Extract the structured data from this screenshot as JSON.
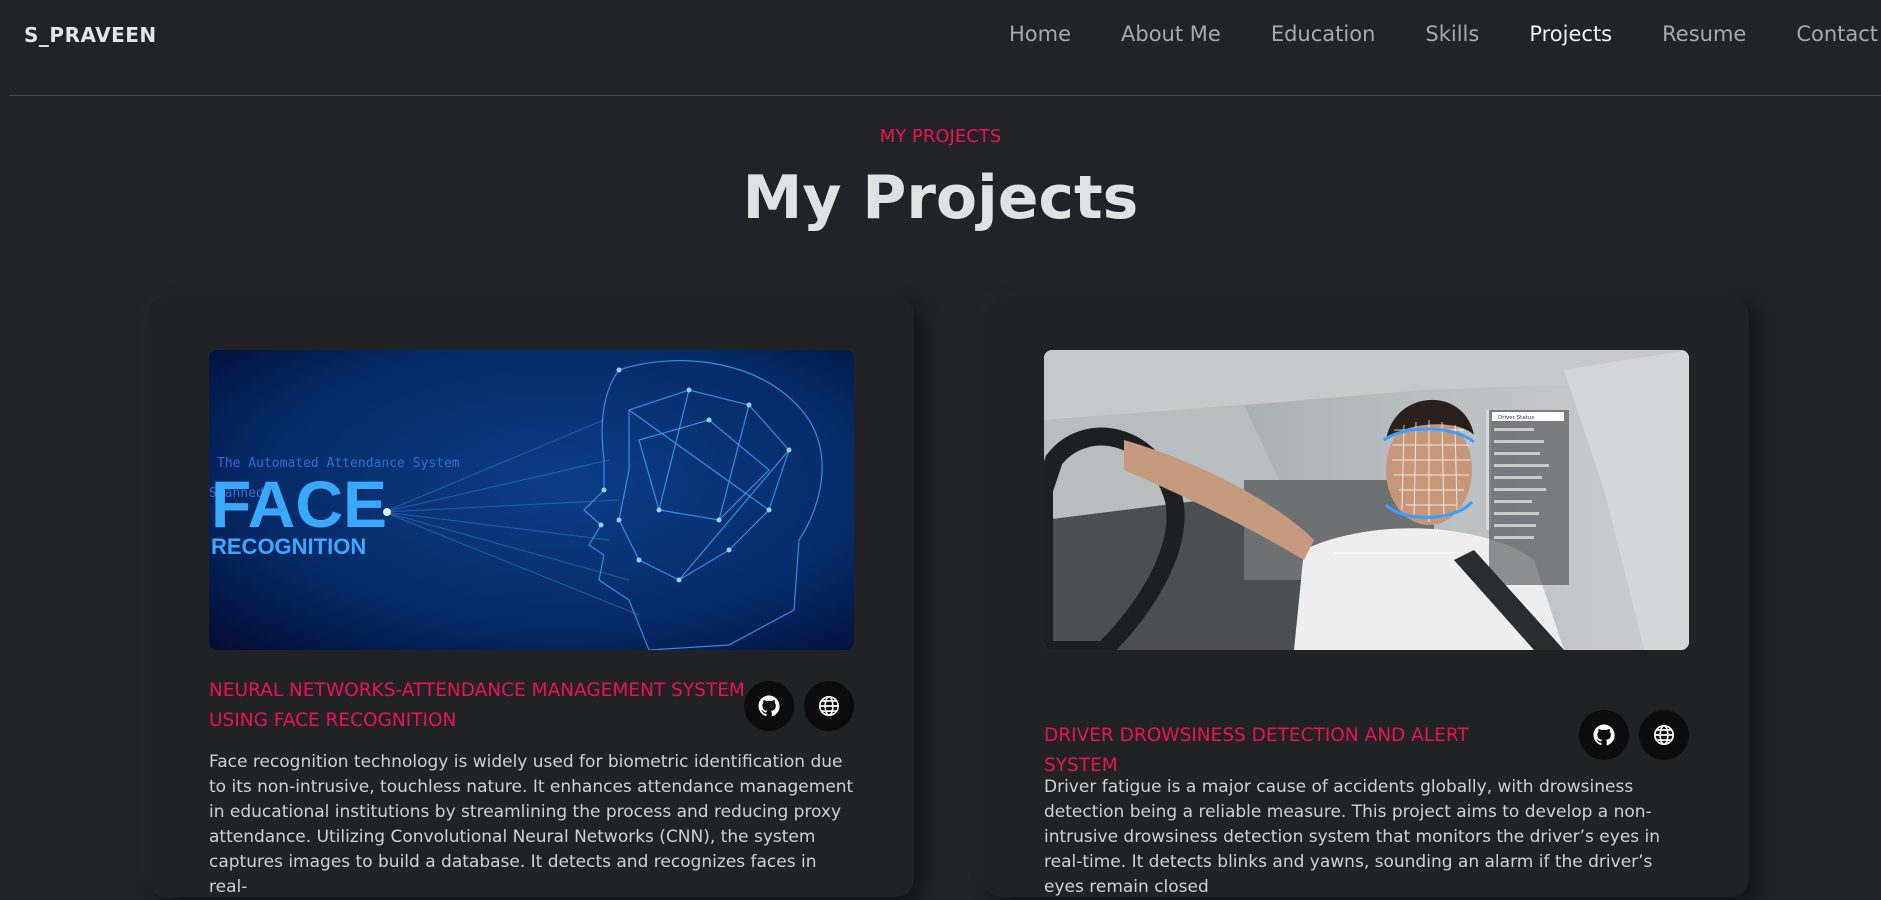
{
  "header": {
    "brand": "S_PRAVEEN",
    "nav": [
      {
        "label": "Home"
      },
      {
        "label": "About Me"
      },
      {
        "label": "Education"
      },
      {
        "label": "Skills"
      },
      {
        "label": "Projects",
        "active": true
      },
      {
        "label": "Resume"
      },
      {
        "label": "Contact"
      }
    ]
  },
  "section": {
    "eyebrow": "MY PROJECTS",
    "title": "My Projects"
  },
  "projects": [
    {
      "image_text": {
        "caption": "The Automated Attendance System",
        "subcaption": "Scanned",
        "big": "FACE",
        "small": "RECOGNITION"
      },
      "title": "NEURAL NETWORKS-ATTENDANCE MANAGEMENT SYSTEM USING FACE RECOGNITION",
      "description": "Face recognition technology is widely used for biometric identification due to its non-intrusive, touchless nature. It enhances attendance management in educational institutions by streamlining the process and reducing proxy attendance. Utilizing Convolutional Neural Networks (CNN), the system captures images to build a database. It detects and recognizes faces in real-",
      "github_icon": "github-icon",
      "web_icon": "globe-icon"
    },
    {
      "image_text": {
        "panel_title": "Driver Status"
      },
      "title": "DRIVER DROWSINESS DETECTION AND ALERT SYSTEM",
      "description": "Driver fatigue is a major cause of accidents globally, with drowsiness detection being a reliable measure. This project aims to develop a non-intrusive drowsiness detection system that monitors the driver’s eyes in real-time. It detects blinks and yawns, sounding an alarm if the driver’s eyes remain closed",
      "github_icon": "github-icon",
      "web_icon": "globe-icon"
    }
  ],
  "colors": {
    "background": "#212328",
    "accent": "#e8134e",
    "card": "#202226"
  }
}
